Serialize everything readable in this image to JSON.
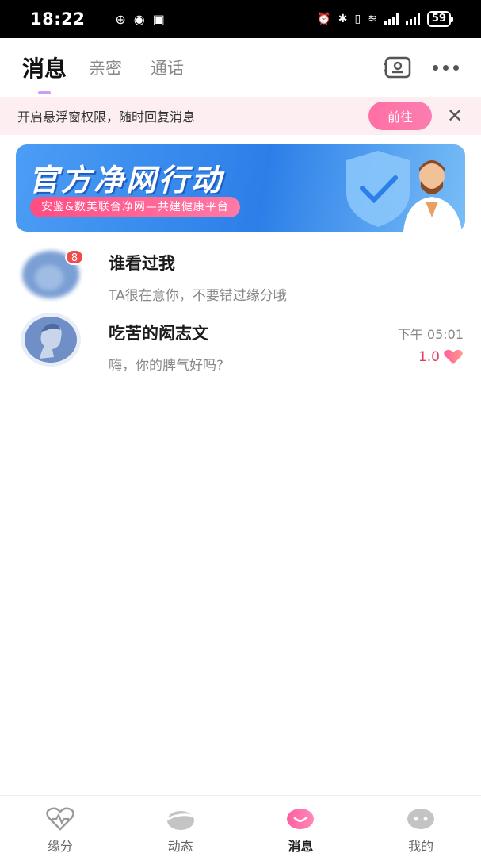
{
  "status_bar": {
    "time": "18:22",
    "battery": "59",
    "left_icons": [
      "nfc-icon",
      "eye-icon",
      "n-icon"
    ],
    "right_icons": [
      "alarm-icon",
      "bluetooth-icon",
      "vibrate-icon",
      "wifi-icon",
      "signal-icon",
      "signal-icon"
    ]
  },
  "tabs": [
    {
      "label": "消息",
      "active": true
    },
    {
      "label": "亲密",
      "active": false
    },
    {
      "label": "通话",
      "active": false
    }
  ],
  "notice": {
    "text": "开启悬浮窗权限，随时回复消息",
    "button": "前往",
    "close": "✕"
  },
  "banner": {
    "title": "官方净网行动",
    "subtitle": "安鉴&数美联合净网—共建健康平台"
  },
  "conversations": [
    {
      "name": "谁看过我",
      "message": "TA很在意你，不要错过缘分哦",
      "badge": "8",
      "time": "",
      "score": ""
    },
    {
      "name": "吃苦的闳志文",
      "message": "嗨，你的脾气好吗?",
      "badge": "",
      "time": "下午 05:01",
      "score": "1.0"
    }
  ],
  "bottom_nav": [
    {
      "label": "缘分",
      "icon": "heart-pulse-icon",
      "active": false
    },
    {
      "label": "动态",
      "icon": "planet-icon",
      "active": false
    },
    {
      "label": "消息",
      "icon": "chat-bubble-icon",
      "active": true
    },
    {
      "label": "我的",
      "icon": "face-icon",
      "active": false
    }
  ],
  "colors": {
    "accent": "#ff6fa4",
    "badge": "#f04c4c",
    "score": "#e03c62",
    "banner": "#2c7fe8",
    "notice_bg": "#fdeff1"
  }
}
